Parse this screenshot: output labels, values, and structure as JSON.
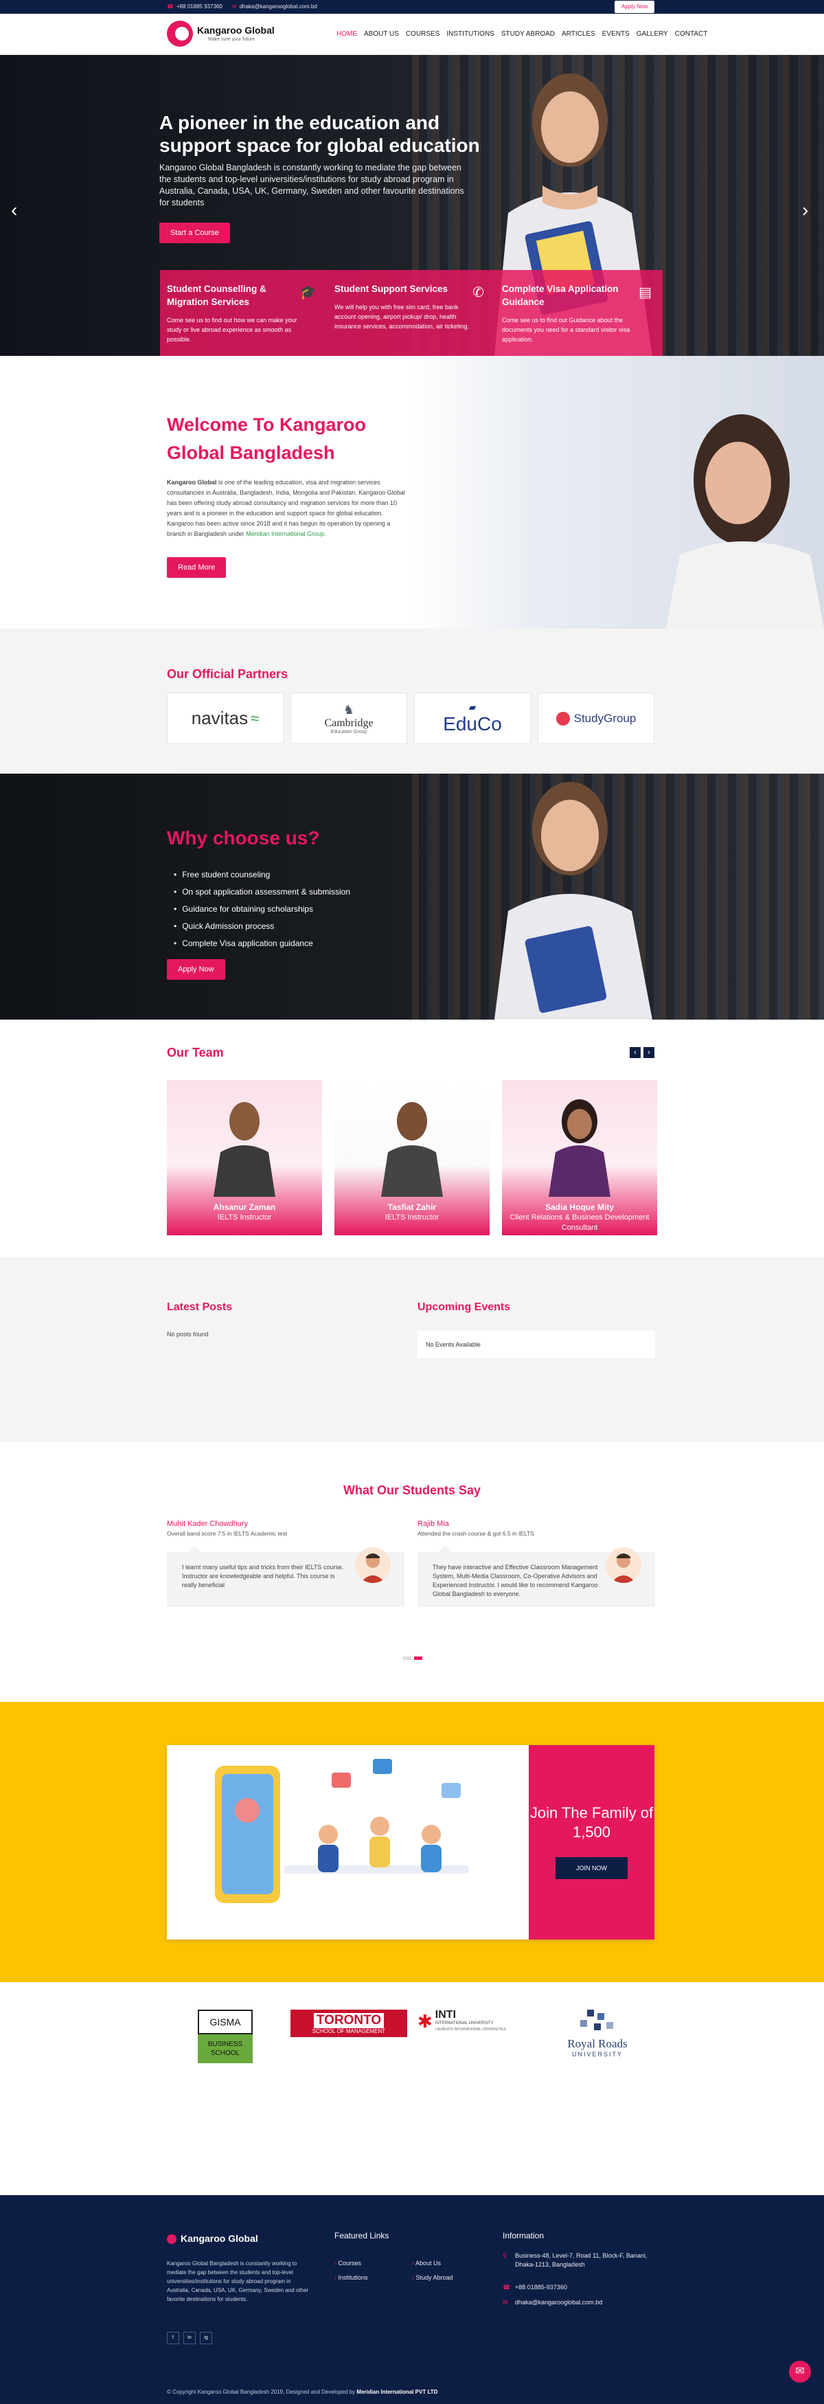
{
  "topbar": {
    "phone": "+88 01885 937360",
    "email": "dhaka@kangarooglobal.com.bd",
    "apply": "Apply Now"
  },
  "brand": {
    "name": "Kangaroo Global",
    "tagline": "Make sure your future",
    "accent": "#e5185f",
    "navy": "#0d1e45",
    "yellow": "#fbc300"
  },
  "nav": [
    "HOME",
    "ABOUT US",
    "COURSES",
    "INSTITUTIONS",
    "STUDY ABROAD",
    "ARTICLES",
    "EVENTS",
    "GALLERY",
    "CONTACT"
  ],
  "hero": {
    "title": "A pioneer in the education and support space for global education",
    "text": "Kangaroo Global Bangladesh is constantly working to mediate the gap between the students and top-level universities/institutions for study abroad program in Australia, Canada, USA, UK, Germany, Sweden and other favourite destinations for students",
    "button": "Start a Course",
    "cards": [
      {
        "title": "Student Counselling & Migration Services",
        "text": "Come see us to find out how we can make your study or live abroad experience as smooth as possible.",
        "icon": "graduation-cap-icon"
      },
      {
        "title": "Student Support Services",
        "text": "We will help you with free sim card, free bank account opening, airport pickup/ drop, health insurance services, accommodation, air ticketing.",
        "icon": "phone-icon"
      },
      {
        "title": "Complete Visa Application Guidance",
        "text": "Come see us to find out Guidance about the documents you need for a standard visitor visa application.",
        "icon": "passport-icon"
      }
    ]
  },
  "welcome": {
    "title": "Welcome To Kangaroo Global Bangladesh",
    "text_strong": "Kangaroo Global",
    "text": " is one of the leading education, visa and migration services consultancies in Australia, Bangladesh, India, Mongolia and Pakistan. Kangaroo Global has been offering study abroad consultancy and migration services for more than 10 years and is a pioneer in the education and support space for global education. Kangaroo has been active since 2018 and it has begun its operation by opening a branch in Bangladesh under ",
    "link": "Meridian International Group.",
    "button": "Read More"
  },
  "partners": {
    "title": "Our Official Partners",
    "logos": [
      "navitas",
      "Cambridge",
      "Education Group",
      "EduCo",
      "StudyGroup"
    ]
  },
  "why": {
    "title": "Why choose us?",
    "items": [
      "Free student counseling",
      "On spot application assessment & submission",
      "Guidance for obtaining scholarships",
      "Quick Admission process",
      "Complete Visa application guidance"
    ],
    "button": "Apply Now"
  },
  "team": {
    "title": "Our Team",
    "members": [
      {
        "name": "Ahsanur Zaman",
        "role": "IELTS Instructor"
      },
      {
        "name": "Tasfiat Zahir",
        "role": "IELTS Instructor"
      },
      {
        "name": "Sadia Hoque Mity",
        "role": "Client Relations & Business Development Consultant"
      }
    ]
  },
  "posts": {
    "latest_title": "Latest Posts",
    "latest_empty": "No posts found",
    "events_title": "Upcoming Events",
    "events_empty": "No Events Available"
  },
  "testimonials": {
    "title": "What Our Students Say",
    "items": [
      {
        "name": "Muhit Kader Chowdhury",
        "sub": "Overall band score 7.5 in IELTS Academic test",
        "text": "I learnt many useful tips and tricks from their IELTS course. Instructor are knowledgeable and helpful. This course is really beneficial"
      },
      {
        "name": "Rajib Mia",
        "sub": "Attended the crash course & got 6.5 in IELTS",
        "text": "They have interactive and Effective Classroom Management System, Multi-Media Classroom, Co-Operative Advisors and Experienced Instructor. I would like to recommend Kangaroo Global Bangladesh to everyone."
      }
    ]
  },
  "join": {
    "title": "Join The Family of 1,500",
    "button": "JOIN NOW"
  },
  "unis": [
    {
      "l1": "GISMA",
      "l2": "BUSINESS",
      "l3": "SCHOOL"
    },
    {
      "l1": "TORONTO",
      "l2": "SCHOOL OF MANAGEMENT"
    },
    {
      "l1": "INTI",
      "l2": "INTERNATIONAL UNIVERSITY",
      "l3": "LAUREATE INTERNATIONAL UNIVERSITIES"
    },
    {
      "l1": "Royal Roads",
      "l2": "UNIVERSITY"
    }
  ],
  "footer": {
    "brand": "Kangaroo Global",
    "desc": "Kangaroo Global Bangladesh is constantly working to mediate the gap between the students and top-level universities/institutions for study abroad program in Australia, Canada, USA, UK, Germany, Sweden and other favorite destinations for students.",
    "social": [
      "f",
      "in",
      "ig"
    ],
    "featured_title": "Featured Links",
    "links": [
      "Courses",
      "About Us",
      "Institutions",
      "Study Abroad"
    ],
    "info_title": "Information",
    "address": "Business-48, Level-7, Road 11, Block-F, Banani, Dhaka-1213, Bangladesh",
    "phone": "+88 01885-937360",
    "email": "dhaka@kangarooglobal.com.bd",
    "copy": "© Copyright Kangaroo Global Bangladesh 2019, Designed and Developed by ",
    "copy_by": "Meridian International PVT LTD"
  }
}
